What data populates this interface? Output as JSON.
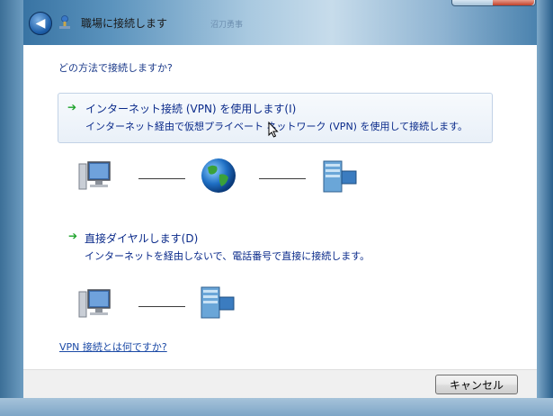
{
  "window": {
    "title": "職場に接続します",
    "faint_title": "沼刀勇事"
  },
  "dialog": {
    "question": "どの方法で接続しますか?",
    "options": [
      {
        "title": "インターネット接続 (VPN) を使用します(I)",
        "description": "インターネット経由で仮想プライベート ネットワーク (VPN) を使用して接続します。",
        "icons": [
          "computer-icon",
          "globe-icon",
          "server-icon"
        ]
      },
      {
        "title": "直接ダイヤルします(D)",
        "description": "インターネットを経由しないで、電話番号で直接に接続します。",
        "icons": [
          "computer-icon",
          "server-icon"
        ]
      }
    ],
    "help_link": "VPN 接続とは何ですか?",
    "cancel_label": "キャンセル"
  },
  "colors": {
    "link": "#1c4aa6",
    "option_text": "#0a2a8a",
    "arrow": "#1ea32b"
  }
}
